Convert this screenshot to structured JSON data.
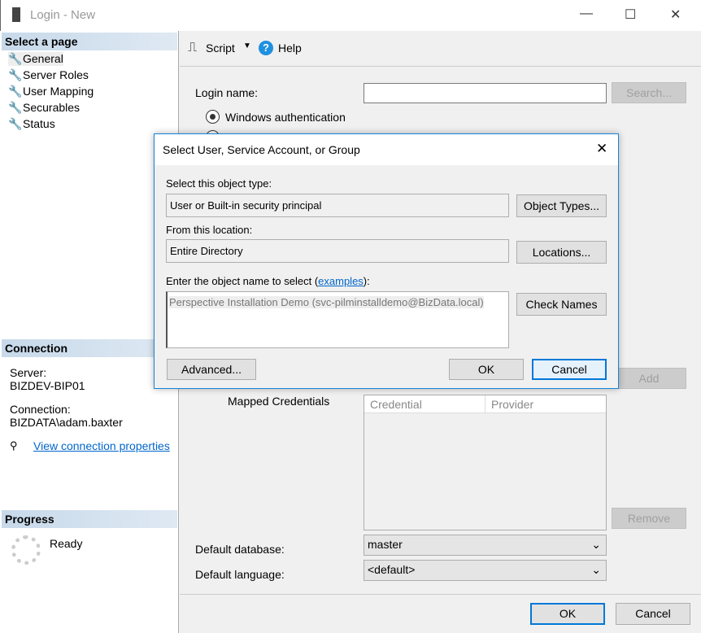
{
  "window": {
    "title": "Login - New",
    "minimize": "—",
    "maximize": "☐",
    "close": "✕"
  },
  "sidebar": {
    "select_page": "Select a page",
    "items": [
      {
        "label": "General"
      },
      {
        "label": "Server Roles"
      },
      {
        "label": "User Mapping"
      },
      {
        "label": "Securables"
      },
      {
        "label": "Status"
      }
    ],
    "connection": {
      "header": "Connection",
      "server_label": "Server:",
      "server": "BIZDEV-BIP01",
      "connection_label": "Connection:",
      "connection": "BIZDATA\\adam.baxter",
      "view_link": "View connection properties"
    },
    "progress": {
      "header": "Progress",
      "status": "Ready"
    }
  },
  "toolbar": {
    "script": "Script",
    "help": "Help"
  },
  "main": {
    "login_name_label": "Login name:",
    "login_name": "",
    "search": "Search...",
    "windows_auth": "Windows authentication",
    "mapped_credentials": "Mapped Credentials",
    "columns": [
      "Credential",
      "Provider"
    ],
    "add": "Add",
    "remove": "Remove",
    "default_database_label": "Default database:",
    "default_database": "master",
    "default_language_label": "Default language:",
    "default_language": "<default>",
    "ok": "OK",
    "cancel": "Cancel"
  },
  "dialog": {
    "title": "Select User, Service Account, or Group",
    "object_type_label": "Select this object type:",
    "object_type": "User or Built-in security principal",
    "object_types_btn": "Object Types...",
    "location_label": "From this location:",
    "location": "Entire Directory",
    "locations_btn": "Locations...",
    "name_label": "Enter the object name to select (",
    "examples": "examples",
    "name_label_end": "):",
    "name_value": "Perspective Installation Demo (svc-pilminstalldemo@BizData.local)",
    "check_names": "Check Names",
    "advanced": "Advanced...",
    "ok": "OK",
    "cancel": "Cancel"
  }
}
